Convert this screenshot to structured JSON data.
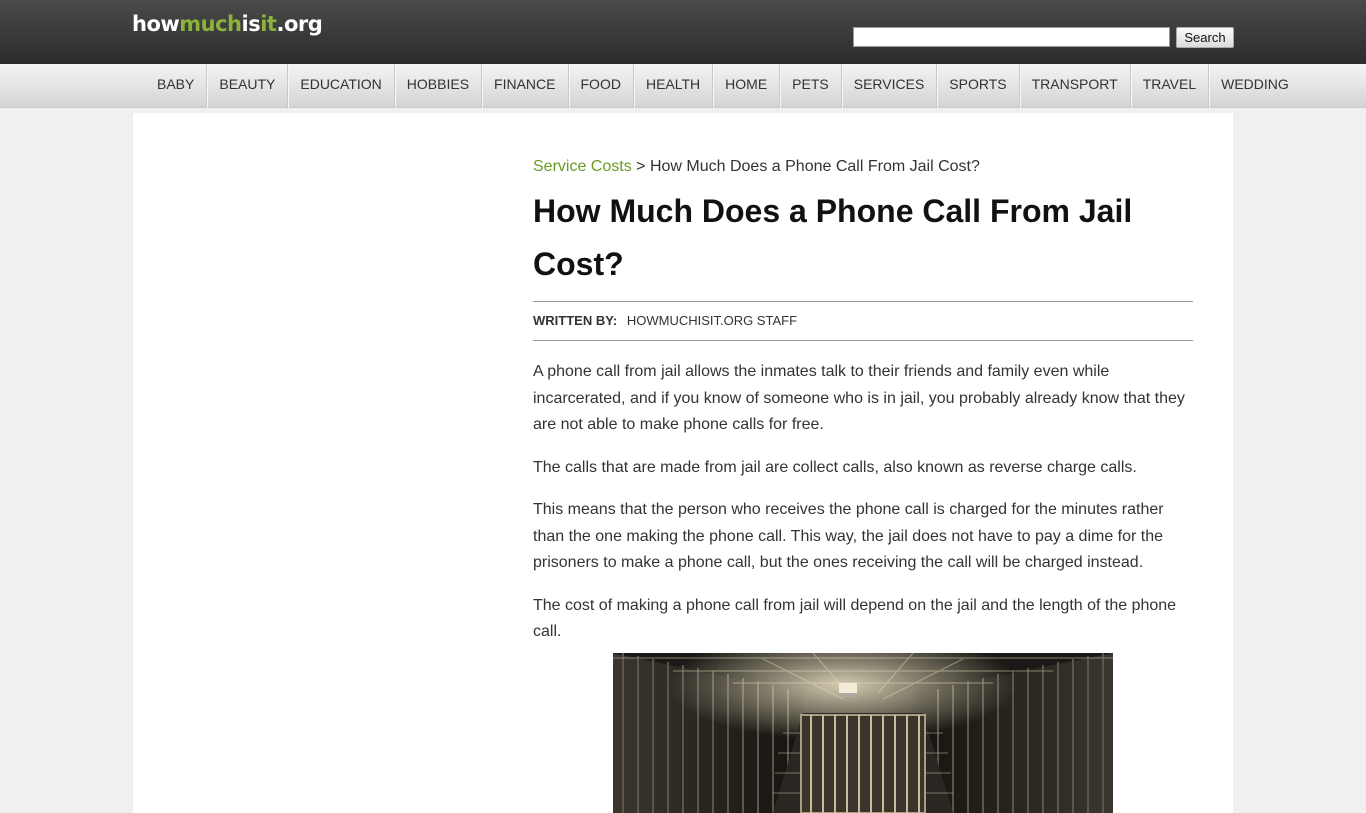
{
  "site": {
    "logo_parts": [
      "how",
      "much",
      "is",
      "it",
      ".org"
    ]
  },
  "search": {
    "value": "",
    "placeholder": "",
    "button_label": "Search"
  },
  "nav": {
    "items": [
      "BABY",
      "BEAUTY",
      "EDUCATION",
      "HOBBIES",
      "FINANCE",
      "FOOD",
      "HEALTH",
      "HOME",
      "PETS",
      "SERVICES",
      "SPORTS",
      "TRANSPORT",
      "TRAVEL",
      "WEDDING"
    ]
  },
  "breadcrumb": {
    "link": "Service Costs",
    "separator": ">",
    "current": "How Much Does a Phone Call From Jail Cost?"
  },
  "article": {
    "title": "How Much Does a Phone Call From Jail Cost?",
    "byline_label": "WRITTEN BY:",
    "byline_author": "HOWMUCHISIT.ORG STAFF",
    "paragraphs": [
      "A phone call from jail allows the inmates talk to their friends and family even while incarcerated, and if you know of someone who is in jail, you probably already know that they are not able to make phone calls for free.",
      "The calls that are made from jail are collect calls, also known as reverse charge calls.",
      "This means that the person who receives the phone call is charged for the minutes rather than the one making the phone call.  This way, the jail does not have to pay a dime for the prisoners to make a phone call, but the ones receiving the call will be charged instead.",
      "The cost of making a phone call from jail will depend on the jail and the length of the phone call."
    ]
  },
  "colors": {
    "accent_green": "#8bb33a",
    "link_green": "#6a9a1f",
    "header_dark": "#3a3a3a"
  }
}
